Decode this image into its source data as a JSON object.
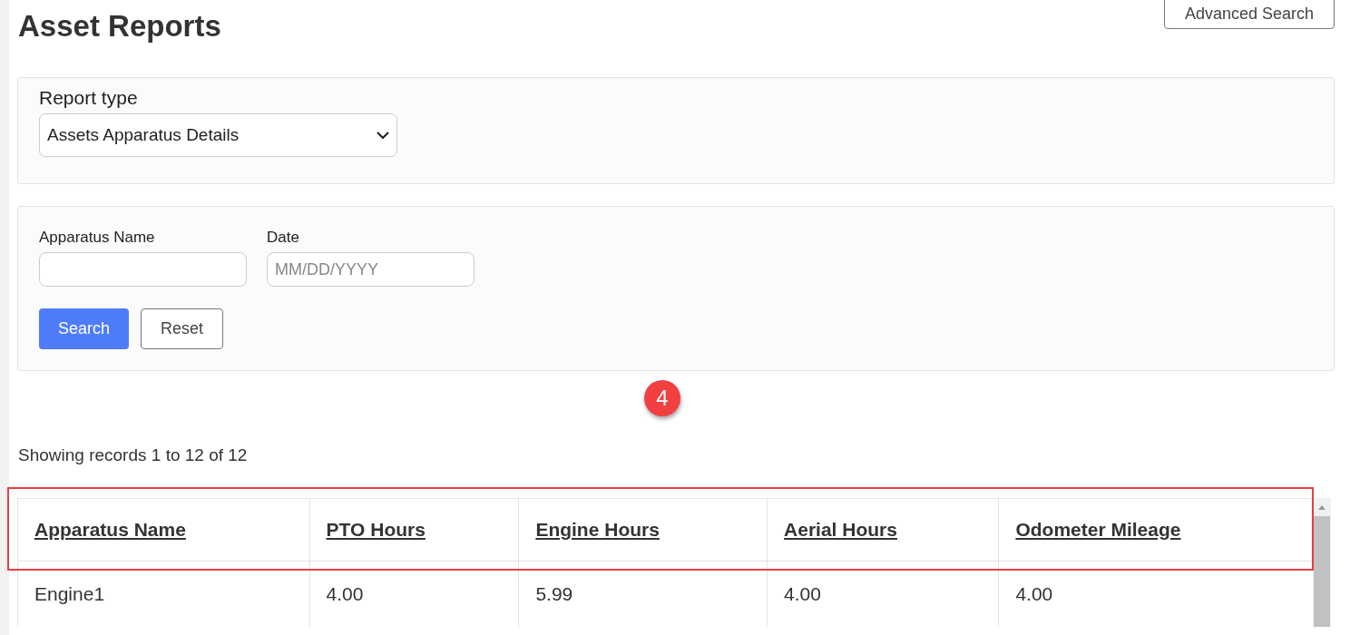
{
  "page": {
    "title": "Asset Reports"
  },
  "advanced_search_button": "Advanced Search",
  "report_type": {
    "label": "Report type",
    "value": "Assets Apparatus Details"
  },
  "filters": [
    {
      "label": "Apparatus Name"
    },
    {
      "label": "Date",
      "placeholder": "MM/DD/YYYY"
    }
  ],
  "buttons": [
    {
      "label": "Search",
      "kind": "primary"
    },
    {
      "label": "Reset",
      "kind": "secondary"
    }
  ],
  "callout": {
    "number": "4"
  },
  "records_summary": "Showing records 1 to 12 of 12",
  "table": {
    "columns": [
      "Apparatus Name",
      "PTO Hours",
      "Engine Hours",
      "Aerial Hours",
      "Odometer Mileage"
    ],
    "rows": [
      [
        "Engine1",
        "4.00",
        "5.99",
        "4.00",
        "4.00"
      ]
    ]
  }
}
